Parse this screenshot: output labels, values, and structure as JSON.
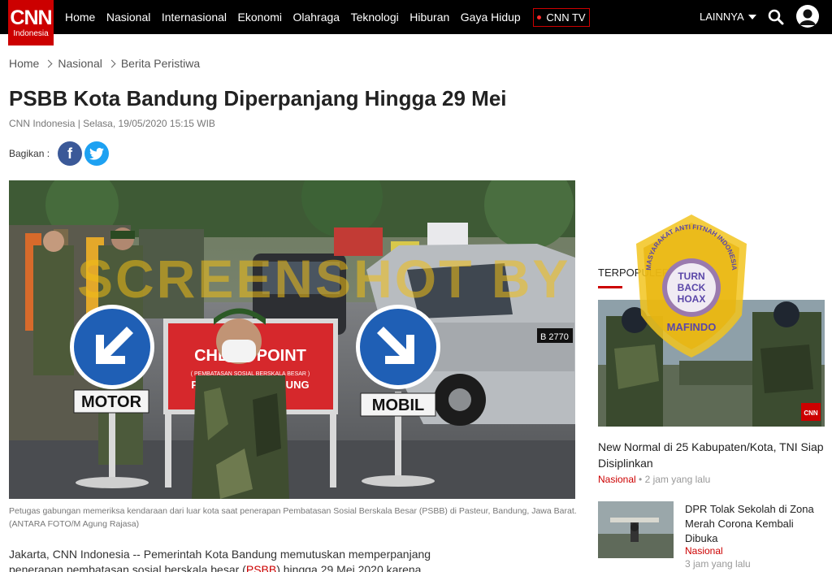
{
  "nav": {
    "logo_text": "CNN",
    "logo_sub": "Indonesia",
    "links": [
      "Home",
      "Nasional",
      "Internasional",
      "Ekonomi",
      "Olahraga",
      "Teknologi",
      "Hiburan",
      "Gaya Hidup"
    ],
    "tv_label": "CNN TV",
    "more_label": "LAINNYA"
  },
  "breadcrumb": [
    "Home",
    "Nasional",
    "Berita Peristiwa"
  ],
  "article": {
    "title": "PSBB Kota Bandung Diperpanjang Hingga 29 Mei",
    "byline": "CNN Indonesia | Selasa, 19/05/2020 15:15 WIB",
    "share_label": "Bagikan :",
    "share_fb": "f",
    "caption": "Petugas gabungan memeriksa kendaraan dari luar kota saat penerapan Pembatasan Sosial Berskala Besar (PSBB) di Pasteur, Bandung, Jawa Barat. (ANTARA FOTO/M Agung Rajasa)",
    "body_line1": "Jakarta, CNN Indonesia -- Pemerintah Kota Bandung memutuskan memperpanjang",
    "body_line2_pre": "penerapan pembatasan sosial berskala besar (",
    "body_link": "PSBB",
    "body_line2_post": ") hingga 29 Mei 2020 karena"
  },
  "photo": {
    "sign_left": "MOTOR",
    "sign_right": "MOBIL",
    "banner_title": "CHECK POINT",
    "banner_sub": "( PEMBATASAN SOSIAL BERSKALA BESAR )",
    "banner_line3": "PSBB KOTA BANDUNG",
    "plate": "B 2770"
  },
  "watermark": {
    "text": "SCREENSHOT BY",
    "badge_top": "MASYARAKAT ANTI FITNAH INDONESIA",
    "badge_center": [
      "TURN",
      "BACK",
      "HOAX"
    ],
    "badge_bottom": "MAFINDO"
  },
  "sidebar": {
    "heading": "TERPOPULER",
    "item1": {
      "title": "New Normal di 25 Kabupaten/Kota, TNI Siap Disiplinkan",
      "category": "Nasional",
      "time": "• 2 jam yang lalu",
      "img_tag": "CNN"
    },
    "item2": {
      "title": "DPR Tolak Sekolah di Zona Merah Corona Kembali Dibuka",
      "category": "Nasional",
      "time": "3 jam yang lalu"
    }
  },
  "colors": {
    "brand": "#cc0000",
    "nav_bg": "#000000",
    "facebook": "#3b5998",
    "twitter": "#1da1f2"
  }
}
